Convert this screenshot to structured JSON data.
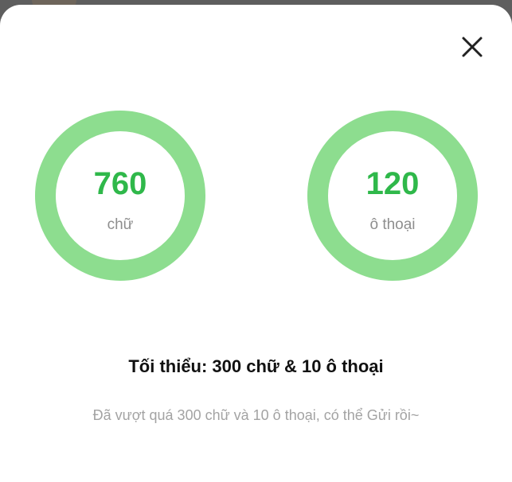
{
  "colors": {
    "ring": "#8ddd8f",
    "value": "#2fb84a",
    "unit": "#8e8e8e",
    "minimum": "#111111",
    "status": "#a3a3a3"
  },
  "dialog": {
    "close_icon": "close-icon",
    "counters": [
      {
        "value": "760",
        "unit": "chữ"
      },
      {
        "value": "120",
        "unit": "ô thoại"
      }
    ],
    "minimum_text": "Tối thiểu: 300 chữ & 10 ô thoại",
    "status_text": "Đã vượt quá 300 chữ và 10 ô thoại, có thể Gửi rồi~"
  }
}
